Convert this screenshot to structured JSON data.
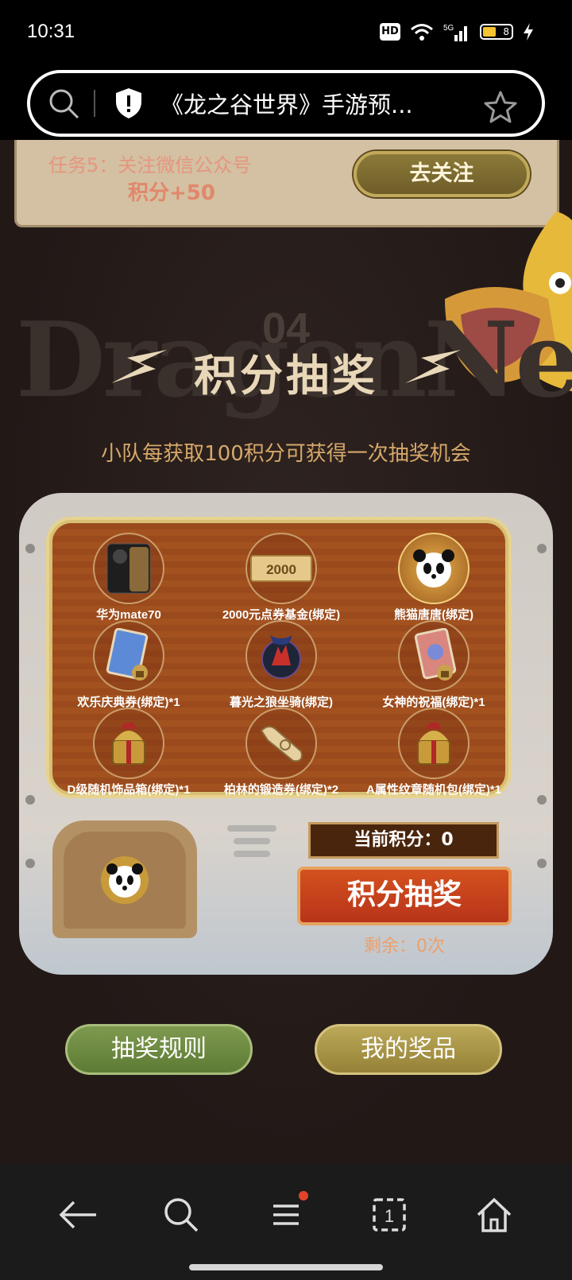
{
  "status_bar": {
    "time": "10:31",
    "hd": "HD",
    "battery": "8"
  },
  "address_bar": {
    "title": "《龙之谷世界》手游预..."
  },
  "task": {
    "label": "任务5：关注微信公众号",
    "points": "积分+50",
    "button": "去关注"
  },
  "section": {
    "number": "04",
    "title": "积分抽奖",
    "subtitle": "小队每获取100积分可获得一次抽奖机会"
  },
  "prizes": [
    {
      "label": "华为mate70",
      "icon": "phone-icon"
    },
    {
      "label": "2000元点券基金(绑定)",
      "icon": "voucher-icon",
      "badge": "2000"
    },
    {
      "label": "熊猫唐唐(绑定)",
      "icon": "panda-icon"
    },
    {
      "label": "欢乐庆典券(绑定)*1",
      "icon": "card-locked-icon"
    },
    {
      "label": "暮光之狼坐骑(绑定)",
      "icon": "wolf-mount-icon"
    },
    {
      "label": "女神的祝福(绑定)*1",
      "icon": "card-locked-icon"
    },
    {
      "label": "D级随机饰品箱(绑定)*1",
      "icon": "gift-chest-icon"
    },
    {
      "label": "柏林的锻造券(绑定)*2",
      "icon": "scroll-icon"
    },
    {
      "label": "A属性纹章随机包(绑定)*1",
      "icon": "gift-chest-icon"
    }
  ],
  "draw": {
    "points_label": "当前积分：0",
    "button": "积分抽奖",
    "remaining": "剩余：0次"
  },
  "buttons": {
    "rules": "抽奖规则",
    "my_prizes": "我的奖品"
  },
  "colors": {
    "accent": "#d6a86a",
    "draw_button": "#c8401c",
    "board": "#9a4a1c"
  }
}
